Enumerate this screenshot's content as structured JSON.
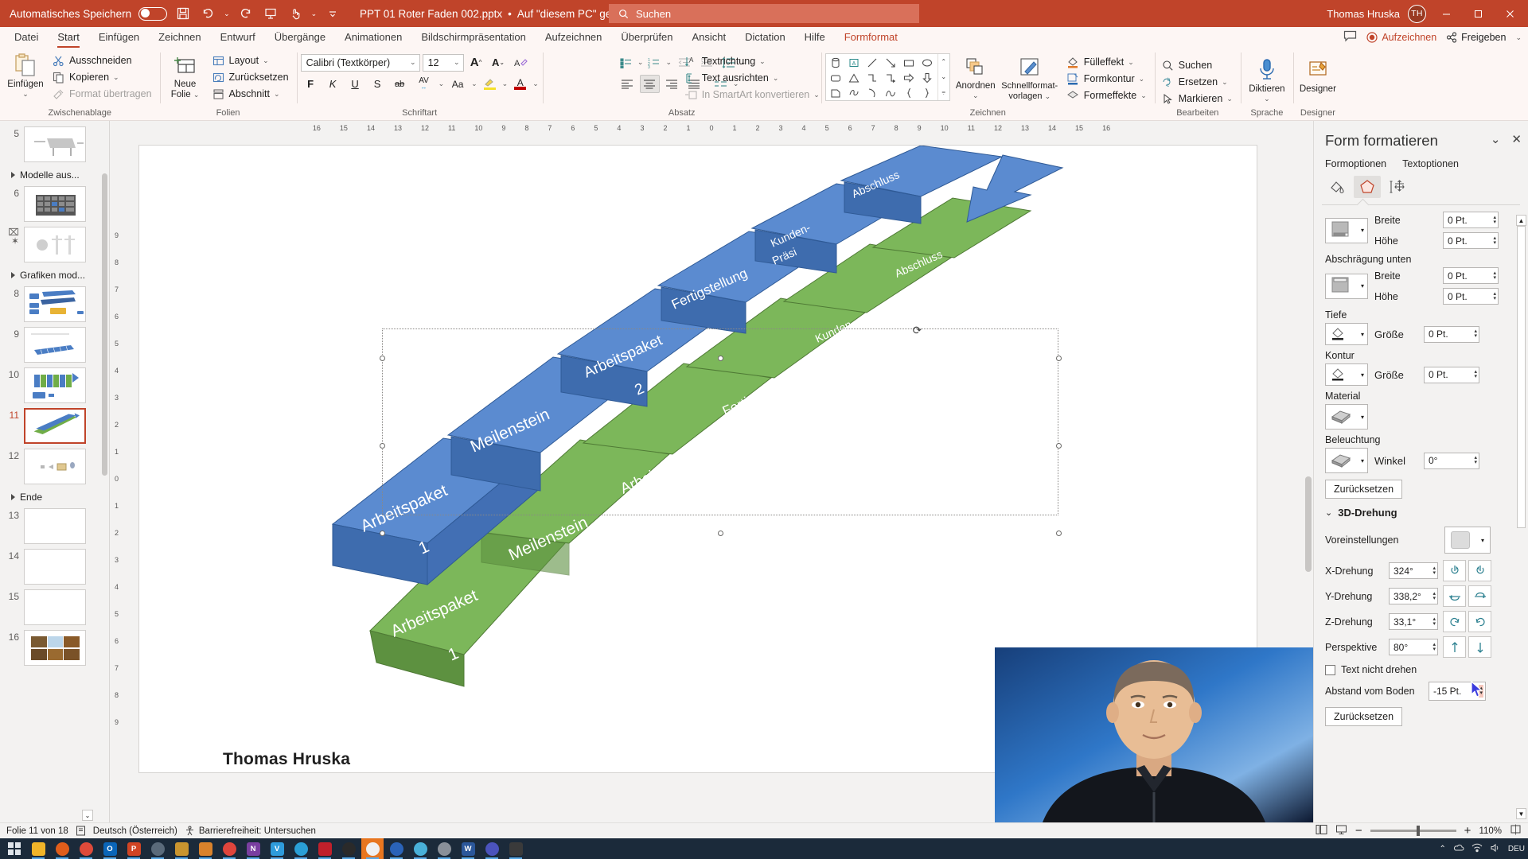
{
  "titlebar": {
    "autosave_label": "Automatisches Speichern",
    "autosave_state": "off",
    "document_title": "PPT 01 Roter Faden 002.pptx",
    "save_location": "Auf \"diesem PC\" gespeichert",
    "search_placeholder": "Suchen",
    "user_name": "Thomas Hruska",
    "user_initials": "TH",
    "quick_access": [
      "save-icon",
      "undo-icon",
      "redo-icon",
      "present-icon",
      "touch-mode-icon",
      "more-icon"
    ],
    "window_buttons": [
      "minimize",
      "restore",
      "close"
    ]
  },
  "menubar": {
    "items": [
      {
        "label": "Datei",
        "state": "normal"
      },
      {
        "label": "Start",
        "state": "active"
      },
      {
        "label": "Einfügen",
        "state": "normal"
      },
      {
        "label": "Zeichnen",
        "state": "normal"
      },
      {
        "label": "Entwurf",
        "state": "normal"
      },
      {
        "label": "Übergänge",
        "state": "normal"
      },
      {
        "label": "Animationen",
        "state": "normal"
      },
      {
        "label": "Bildschirmpräsentation",
        "state": "normal"
      },
      {
        "label": "Aufzeichnen",
        "state": "normal"
      },
      {
        "label": "Überprüfen",
        "state": "normal"
      },
      {
        "label": "Ansicht",
        "state": "normal"
      },
      {
        "label": "Dictation",
        "state": "normal"
      },
      {
        "label": "Hilfe",
        "state": "normal"
      },
      {
        "label": "Formformat",
        "state": "contextual"
      }
    ],
    "right": {
      "comment_label": "",
      "record_label": "Aufzeichnen",
      "share_label": "Freigeben"
    }
  },
  "ribbon": {
    "groups": [
      {
        "name": "Zwischenablage",
        "label": "Zwischenablage",
        "big": {
          "label": "Einfügen",
          "caret": "⌄"
        },
        "items": [
          {
            "label": "Ausschneiden",
            "icon": "scissors-icon",
            "disabled": false
          },
          {
            "label": "Kopieren",
            "icon": "copy-icon",
            "disabled": false,
            "caret": true
          },
          {
            "label": "Format übertragen",
            "icon": "format-painter-icon",
            "disabled": true
          }
        ]
      },
      {
        "name": "Folien",
        "label": "Folien",
        "big": {
          "label": "Neue\nFolie",
          "caret": "⌄"
        },
        "items": [
          {
            "label": "Layout",
            "icon": "layout-icon",
            "caret": true
          },
          {
            "label": "Zurücksetzen",
            "icon": "reset-icon"
          },
          {
            "label": "Abschnitt",
            "icon": "section-icon",
            "caret": true
          }
        ]
      },
      {
        "name": "Schriftart",
        "label": "Schriftart",
        "font_name": "Calibri (Textkörper)",
        "font_size": "12",
        "buttons_row1": [
          "grow-font",
          "shrink-font",
          "clear-formatting"
        ],
        "buttons_row2": [
          "F",
          "K",
          "U",
          "S",
          "ab",
          "AV",
          "Aa",
          "highlight",
          "font-color"
        ]
      },
      {
        "name": "Absatz",
        "label": "Absatz",
        "items": [
          {
            "label": "Textrichtung",
            "icon": "text-direction-icon",
            "caret": true
          },
          {
            "label": "Text ausrichten",
            "icon": "align-text-icon",
            "caret": true
          },
          {
            "label": "In SmartArt konvertieren",
            "icon": "smartart-icon",
            "disabled": true,
            "caret": true
          }
        ]
      },
      {
        "name": "Zeichnen",
        "label": "Zeichnen",
        "arrange_label": "Anordnen",
        "quickstyles_label": "Schnellformat-\nvorlagen",
        "items": [
          {
            "label": "Fülleffekt",
            "icon": "fill-icon",
            "caret": true
          },
          {
            "label": "Formkontur",
            "icon": "outline-icon",
            "caret": true
          },
          {
            "label": "Formeffekte",
            "icon": "effects-icon",
            "caret": true
          }
        ]
      },
      {
        "name": "Bearbeiten",
        "label": "Bearbeiten",
        "items": [
          {
            "label": "Suchen",
            "icon": "search-icon"
          },
          {
            "label": "Ersetzen",
            "icon": "replace-icon",
            "caret": true
          },
          {
            "label": "Markieren",
            "icon": "select-icon",
            "caret": true
          }
        ]
      },
      {
        "name": "Sprache",
        "label": "Sprache",
        "big": {
          "label": "Diktieren",
          "caret": "⌄"
        }
      },
      {
        "name": "Designer",
        "label": "Designer",
        "big": {
          "label": "Designer",
          "caret": ""
        }
      }
    ]
  },
  "thumbnails": {
    "rows": [
      {
        "type": "slide",
        "num": "5",
        "kind": "grill"
      },
      {
        "type": "section",
        "label": "Modelle aus..."
      },
      {
        "type": "slide",
        "num": "6",
        "kind": "grid-dark"
      },
      {
        "type": "slide",
        "num": "7",
        "kind": "figures",
        "hidden": true
      },
      {
        "type": "section",
        "label": "Grafiken mod..."
      },
      {
        "type": "slide",
        "num": "8",
        "kind": "blocks-blue"
      },
      {
        "type": "slide",
        "num": "9",
        "kind": "blocks-row"
      },
      {
        "type": "slide",
        "num": "10",
        "kind": "blocks-green"
      },
      {
        "type": "slide",
        "num": "11",
        "kind": "blocks-current",
        "current": true
      },
      {
        "type": "slide",
        "num": "12",
        "kind": "icons-small"
      },
      {
        "type": "section",
        "label": "Ende"
      },
      {
        "type": "slide",
        "num": "13",
        "kind": "blank"
      },
      {
        "type": "slide",
        "num": "14",
        "kind": "blank"
      },
      {
        "type": "slide",
        "num": "15",
        "kind": "blank"
      },
      {
        "type": "slide",
        "num": "16",
        "kind": "photos"
      }
    ]
  },
  "ruler": {
    "horizontal": [
      "16",
      "15",
      "14",
      "13",
      "12",
      "11",
      "10",
      "9",
      "8",
      "7",
      "6",
      "5",
      "4",
      "3",
      "2",
      "1",
      "0",
      "1",
      "2",
      "3",
      "4",
      "5",
      "6",
      "7",
      "8",
      "9",
      "10",
      "11",
      "12",
      "13",
      "14",
      "15",
      "16"
    ],
    "vertical": [
      "9",
      "8",
      "7",
      "6",
      "5",
      "4",
      "3",
      "2",
      "1",
      "0",
      "1",
      "2",
      "3",
      "4",
      "5",
      "6",
      "7",
      "8",
      "9"
    ]
  },
  "slide": {
    "title_text": "Thomas Hruska",
    "shape_labels": [
      "Arbeitspaket 1",
      "Meilenstein",
      "Arbeitspaket 2",
      "Fertigstellung",
      "Kunden-Präsi",
      "Abschluss"
    ],
    "colors": {
      "blue": "#4a7dc4",
      "blue_dark": "#3a63a0",
      "green": "#70ad47",
      "green_dark": "#548235"
    }
  },
  "rightpane": {
    "title": "Form formatieren",
    "tabs": [
      {
        "label": "Formoptionen",
        "selected": true
      },
      {
        "label": "Textoptionen",
        "selected": false
      }
    ],
    "icon_tabs": [
      "fill-line-icon",
      "effects-icon",
      "size-properties-icon"
    ],
    "fields": [
      {
        "label": "Breite",
        "value": "0 Pt."
      },
      {
        "label": "Höhe",
        "value": "0 Pt."
      }
    ],
    "bevel_bottom_label": "Abschrägung unten",
    "bevel_bottom_fields": [
      {
        "label": "Breite",
        "value": "0 Pt."
      },
      {
        "label": "Höhe",
        "value": "0 Pt."
      }
    ],
    "depth_label": "Tiefe",
    "depth_field": {
      "label": "Größe",
      "value": "0 Pt."
    },
    "contour_label": "Kontur",
    "contour_field": {
      "label": "Größe",
      "value": "0 Pt."
    },
    "material_label": "Material",
    "lighting_label": "Beleuchtung",
    "lighting_field": {
      "label": "Winkel",
      "value": "0°"
    },
    "reset_label_1": "Zurücksetzen",
    "rotation_section": "3D-Drehung",
    "presets_label": "Voreinstellungen",
    "rotation_fields": [
      {
        "label": "X-Drehung",
        "value": "324°"
      },
      {
        "label": "Y-Drehung",
        "value": "338,2°"
      },
      {
        "label": "Z-Drehung",
        "value": "33,1°"
      },
      {
        "label": "Perspektive",
        "value": "80°"
      }
    ],
    "checkbox_label": "Text nicht drehen",
    "checkbox_checked": false,
    "distance_label": "Abstand vom Boden",
    "distance_value": "-15 Pt.",
    "reset_label_2": "Zurücksetzen"
  },
  "statusbar": {
    "slide_counter": "Folie 11 von 18",
    "language": "Deutsch (Österreich)",
    "accessibility": "Barrierefreiheit: Untersuchen",
    "zoom_level": "110%",
    "zoom_minus": "−",
    "zoom_plus": "+",
    "view_buttons": [
      "normal-view-icon",
      "slide-sorter-icon"
    ]
  },
  "taskbar": {
    "apps": [
      {
        "name": "start-button",
        "glyph": "⊞",
        "color": "#1b2a3a",
        "running": false
      },
      {
        "name": "file-explorer",
        "glyph": "",
        "color": "#f0b429",
        "running": true
      },
      {
        "name": "firefox",
        "glyph": "",
        "color": "#e05d1a",
        "running": true
      },
      {
        "name": "chrome",
        "glyph": "",
        "color": "#de4a3a",
        "running": true
      },
      {
        "name": "outlook",
        "glyph": "O",
        "color": "#0a65b8",
        "running": true
      },
      {
        "name": "powerpoint",
        "glyph": "P",
        "color": "#d04423",
        "running": true
      },
      {
        "name": "settings",
        "glyph": "",
        "color": "#3a4a5a",
        "running": true
      },
      {
        "name": "archive",
        "glyph": "",
        "color": "#c9952f",
        "running": true
      },
      {
        "name": "media-player",
        "glyph": "",
        "color": "#d9822b",
        "running": true
      },
      {
        "name": "flower-app",
        "glyph": "",
        "color": "#e0453c",
        "running": true
      },
      {
        "name": "onenote",
        "glyph": "N",
        "color": "#7a3fa0",
        "running": true
      },
      {
        "name": "camtasia",
        "glyph": "V",
        "color": "#2e9bdb",
        "running": true
      },
      {
        "name": "telegram",
        "glyph": "",
        "color": "#2a9fd6",
        "running": true
      },
      {
        "name": "acrobat",
        "glyph": "",
        "color": "#c0202b",
        "running": true
      },
      {
        "name": "browser-dark",
        "glyph": "",
        "color": "#2a2a2a",
        "running": true
      },
      {
        "name": "recorder-active",
        "glyph": "",
        "color": "#e8761f",
        "running": true
      },
      {
        "name": "blue-app",
        "glyph": "",
        "color": "#2a63b8",
        "running": true
      },
      {
        "name": "mag-app",
        "glyph": "",
        "color": "#49b0d8",
        "running": true
      },
      {
        "name": "grey-app",
        "glyph": "",
        "color": "#8a9099",
        "running": true
      },
      {
        "name": "word",
        "glyph": "W",
        "color": "#2b579a",
        "running": true
      },
      {
        "name": "teams",
        "glyph": "",
        "color": "#4b53bc",
        "running": true
      },
      {
        "name": "clock-app",
        "glyph": "",
        "color": "#3a3a3a",
        "running": true
      }
    ],
    "tray": {
      "language": "DEU",
      "icons": [
        "chevron-up-icon",
        "onedrive-icon",
        "network-icon",
        "volume-icon"
      ]
    }
  }
}
